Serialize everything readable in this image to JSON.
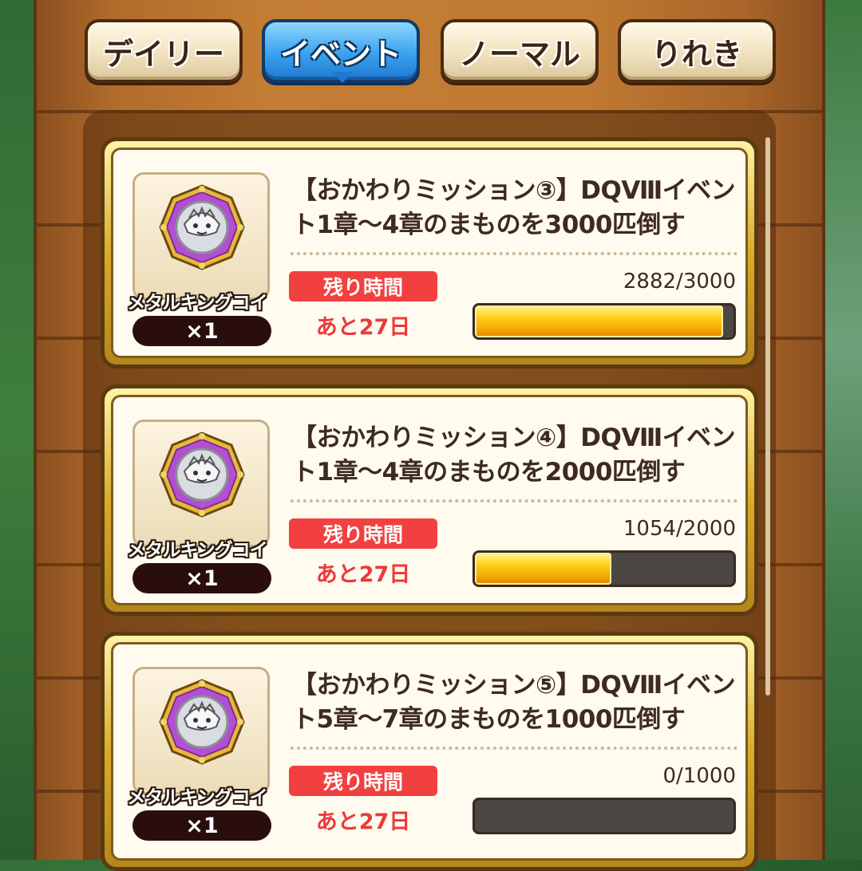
{
  "tabs": [
    {
      "label": "デイリー",
      "active": false
    },
    {
      "label": "イベント",
      "active": true
    },
    {
      "label": "ノーマル",
      "active": false
    },
    {
      "label": "りれき",
      "active": false
    }
  ],
  "missions": [
    {
      "title": "【おかわりミッション③】DQⅧイベント1章～4章のまものを3000匹倒す",
      "reward_name": "メタルキングコイン",
      "reward_qty": "×1",
      "time_label": "残り時間",
      "time_value": "あと27日",
      "progress_text": "2882/3000",
      "progress_fraction": 0.9607
    },
    {
      "title": "【おかわりミッション④】DQⅧイベント1章～4章のまものを2000匹倒す",
      "reward_name": "メタルキングコイン",
      "reward_qty": "×1",
      "time_label": "残り時間",
      "time_value": "あと27日",
      "progress_text": "1054/2000",
      "progress_fraction": 0.527
    },
    {
      "title": "【おかわりミッション⑤】DQⅧイベント5章～7章のまものを1000匹倒す",
      "reward_name": "メタルキングコイン",
      "reward_qty": "×1",
      "time_label": "残り時間",
      "time_value": "あと27日",
      "progress_text": "0/1000",
      "progress_fraction": 0
    }
  ],
  "colors": {
    "active_tab": "#3aa2ee",
    "time_badge": "#f24040",
    "progress_fill": "#ffd21c"
  },
  "icons": {
    "reward": "metal-king-coin-icon"
  }
}
